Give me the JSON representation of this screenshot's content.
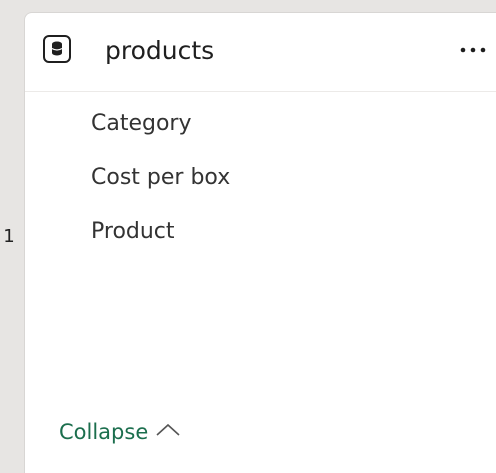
{
  "edge_badge": "1",
  "card": {
    "title": "products",
    "icon": "table-icon",
    "more_icon": "more-options-icon"
  },
  "fields": [
    {
      "label": "Category"
    },
    {
      "label": "Cost per box"
    },
    {
      "label": "Product"
    }
  ],
  "collapse": {
    "label": "Collapse",
    "icon": "chevron-up-icon"
  },
  "colors": {
    "canvas_background": "#e7e5e3",
    "card_background": "#ffffff",
    "collapse_accent": "#1b6e4d",
    "text_primary": "#1f1f1f",
    "text_field": "#333333"
  }
}
